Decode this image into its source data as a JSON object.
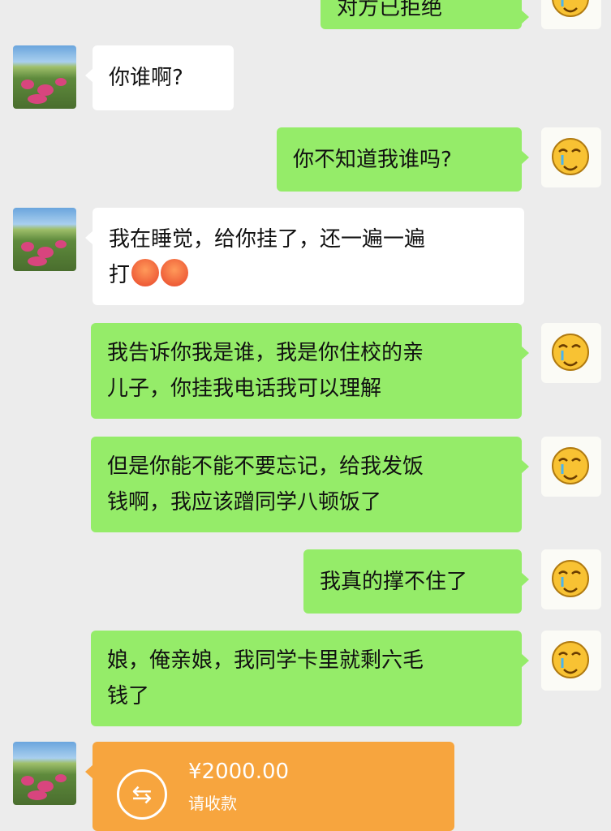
{
  "messages": [
    {
      "side": "right",
      "text": "对方已拒绝",
      "cut": true
    },
    {
      "side": "left",
      "text": "你谁啊?"
    },
    {
      "side": "right",
      "text": "你不知道我谁吗?"
    },
    {
      "side": "left",
      "text": "我在睡觉，给你挂了，还一遍一遍\n打",
      "emoji": "angry-face-icon"
    },
    {
      "side": "right",
      "text": "我告诉你我是谁，我是你住校的亲\n儿子，你挂我电话我可以理解"
    },
    {
      "side": "right",
      "text": "但是你能不能不要忘记，给我发饭\n钱啊，我应该蹭同学八顿饭了"
    },
    {
      "side": "right",
      "text": "我真的撑不住了"
    },
    {
      "side": "right",
      "text": "娘，俺亲娘，我同学卡里就剩六毛\n钱了"
    }
  ],
  "transfer": {
    "amount": "¥2000.00",
    "note": "请收款",
    "icon": "transfer-icon"
  },
  "colors": {
    "background": "#ececec",
    "outgoing_bubble": "#95ec69",
    "incoming_bubble": "#ffffff",
    "transfer_card": "#f7a53e"
  }
}
